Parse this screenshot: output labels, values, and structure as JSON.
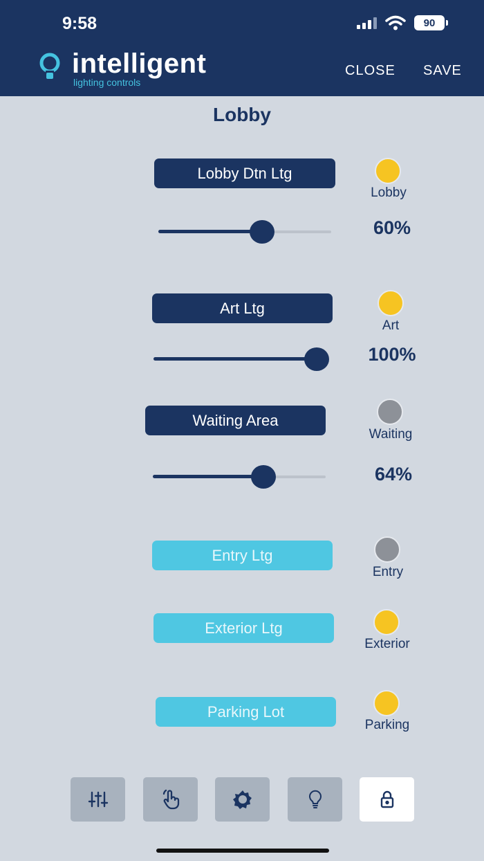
{
  "status_bar": {
    "time": "9:58",
    "battery": "90"
  },
  "header": {
    "logo_word": "intelligent",
    "logo_sub": "lighting controls",
    "close_label": "CLOSE",
    "save_label": "SAVE"
  },
  "page": {
    "title": "Lobby"
  },
  "zones": [
    {
      "label": "Lobby Dtn Ltg",
      "indicator": "Lobby",
      "state": "on",
      "level": 0.6,
      "percent": "60%"
    },
    {
      "label": "Art Ltg",
      "indicator": "Art",
      "state": "on",
      "level": 1.0,
      "percent": "100%"
    },
    {
      "label": "Waiting Area",
      "indicator": "Waiting",
      "state": "off",
      "level": 0.64,
      "percent": "64%"
    },
    {
      "label": "Entry Ltg",
      "indicator": "Entry",
      "state": "off"
    },
    {
      "label": "Exterior Ltg",
      "indicator": "Exterior",
      "state": "on"
    },
    {
      "label": "Parking Lot",
      "indicator": "Parking",
      "state": "on"
    }
  ],
  "tabs": [
    {
      "icon": "sliders-icon"
    },
    {
      "icon": "touch-icon"
    },
    {
      "icon": "gear-icon"
    },
    {
      "icon": "bulb-icon"
    },
    {
      "icon": "lock-icon",
      "active": true
    }
  ],
  "colors": {
    "navy": "#1b3461",
    "cyan": "#4fc7e2",
    "on": "#f6c422",
    "off": "#8d9198",
    "background": "#d2d8e0"
  }
}
